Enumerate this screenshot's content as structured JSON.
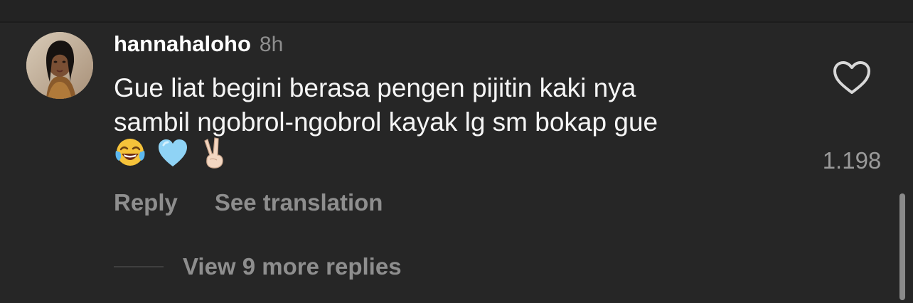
{
  "comment": {
    "username": "hannahaloho",
    "time": "8h",
    "text": "Gue liat begini berasa pengen pijitin kaki nya\nsambil ngobrol-ngobrol kayak lg sm bokap gue",
    "emojis": [
      "face-with-tears-of-joy-icon",
      "light-blue-heart-icon",
      "victory-hand-icon"
    ],
    "likes": "1.198",
    "actions": {
      "reply": "Reply",
      "translate": "See translation"
    },
    "view_replies": "View 9 more replies"
  },
  "colors": {
    "background": "#262626",
    "primary_text": "#ffffff",
    "secondary_text": "#8e8e8e"
  }
}
